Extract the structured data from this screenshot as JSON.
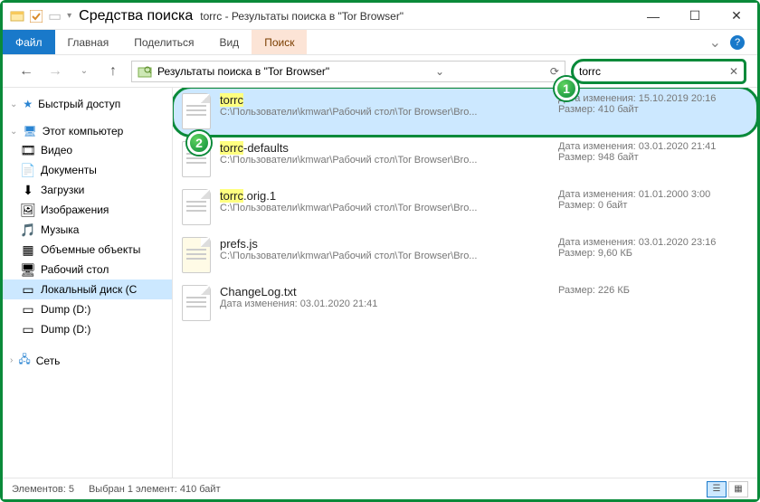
{
  "window": {
    "title": "torrc - Результаты поиска в \"Tor Browser\"",
    "context_tab_label": "Средства поиска"
  },
  "ribbon": {
    "file": "Файл",
    "home": "Главная",
    "share": "Поделиться",
    "view": "Вид",
    "search": "Поиск"
  },
  "address": {
    "path": "Результаты поиска в \"Tor Browser\""
  },
  "search": {
    "query": "torrc"
  },
  "sidebar": {
    "quick": "Быстрый доступ",
    "thispc": "Этот компьютер",
    "items": [
      {
        "icon": "video",
        "label": "Видео"
      },
      {
        "icon": "doc",
        "label": "Документы"
      },
      {
        "icon": "download",
        "label": "Загрузки"
      },
      {
        "icon": "image",
        "label": "Изображения"
      },
      {
        "icon": "music",
        "label": "Музыка"
      },
      {
        "icon": "3d",
        "label": "Объемные объекты"
      },
      {
        "icon": "desktop",
        "label": "Рабочий стол"
      },
      {
        "icon": "drive",
        "label": "Локальный диск (C"
      },
      {
        "icon": "drive",
        "label": "Dump (D:)"
      },
      {
        "icon": "drive",
        "label": "Dump (D:)"
      }
    ],
    "network": "Сеть"
  },
  "results": [
    {
      "name_parts": [
        {
          "t": "torrc",
          "hl": true
        }
      ],
      "path": "C:\\Пользователи\\kmwar\\Рабочий стол\\Tor Browser\\Bro...",
      "date_label": "Дата изменения:",
      "date": "15.10.2019 20:16",
      "size_label": "Размер:",
      "size": "410 байт",
      "selected": true
    },
    {
      "name_parts": [
        {
          "t": "torrc",
          "hl": true
        },
        {
          "t": "-defaults",
          "hl": false
        }
      ],
      "path": "C:\\Пользователи\\kmwar\\Рабочий стол\\Tor Browser\\Bro...",
      "date_label": "Дата изменения:",
      "date": "03.01.2020 21:41",
      "size_label": "Размер:",
      "size": "948 байт"
    },
    {
      "name_parts": [
        {
          "t": "torrc",
          "hl": true
        },
        {
          "t": ".orig.1",
          "hl": false
        }
      ],
      "path": "C:\\Пользователи\\kmwar\\Рабочий стол\\Tor Browser\\Bro...",
      "date_label": "Дата изменения:",
      "date": "01.01.2000 3:00",
      "size_label": "Размер:",
      "size": "0 байт"
    },
    {
      "name_parts": [
        {
          "t": "prefs.js",
          "hl": false
        }
      ],
      "path": "C:\\Пользователи\\kmwar\\Рабочий стол\\Tor Browser\\Bro...",
      "date_label": "Дата изменения:",
      "date": "03.01.2020 23:16",
      "size_label": "Размер:",
      "size": "9,60 КБ",
      "icon": "js"
    },
    {
      "name_parts": [
        {
          "t": "ChangeLog.txt",
          "hl": false
        }
      ],
      "path_label": "Дата изменения: 03.01.2020 21:41",
      "path": "Дата изменения: 03.01.2020 21:41",
      "size_label": "Размер:",
      "size": "226 КБ",
      "icon": "txt"
    }
  ],
  "status": {
    "count": "Элементов: 5",
    "selection": "Выбран 1 элемент: 410 байт"
  },
  "badges": {
    "one": "1",
    "two": "2"
  }
}
